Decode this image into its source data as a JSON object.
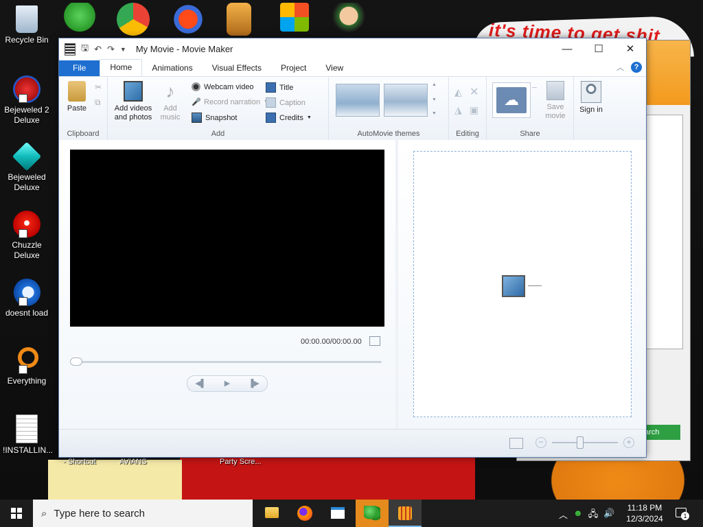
{
  "desktop": {
    "icons": [
      {
        "label": "Recycle Bin"
      },
      {
        "label": "Bejeweled 2 Deluxe"
      },
      {
        "label": "Bejeweled Deluxe"
      },
      {
        "label": "Chuzzle Deluxe"
      },
      {
        "label": "doesnt load"
      },
      {
        "label": "Everything"
      },
      {
        "label": "!INSTALLIN..."
      }
    ],
    "wallpaper_text": "it's time to get shit",
    "bottom_labels": [
      "- Shortcut",
      "AVIANS",
      "Party Scre..."
    ],
    "back_window_button": "arch"
  },
  "window": {
    "title": "My Movie - Movie Maker",
    "controls": {
      "minimize": "—",
      "maximize": "☐",
      "close": "✕"
    },
    "tabs": [
      "File",
      "Home",
      "Animations",
      "Visual Effects",
      "Project",
      "View"
    ],
    "help": "?",
    "ribbon": {
      "clipboard": {
        "label": "Clipboard",
        "paste": "Paste"
      },
      "add": {
        "label": "Add",
        "add_videos": "Add videos and photos",
        "add_music": "Add music",
        "webcam": "Webcam video",
        "narration": "Record narration",
        "snapshot": "Snapshot",
        "title": "Title",
        "caption": "Caption",
        "credits": "Credits"
      },
      "themes": {
        "label": "AutoMovie themes"
      },
      "editing": {
        "label": "Editing"
      },
      "share": {
        "label": "Share",
        "save_movie": "Save movie",
        "sign_in": "Sign in"
      }
    },
    "preview": {
      "timecode": "00:00.00/00:00.00"
    }
  },
  "taskbar": {
    "search_placeholder": "Type here to search",
    "time": "11:18 PM",
    "date": "12/3/2024",
    "notification_count": "1"
  },
  "colors": {
    "accent": "#1e6fd0",
    "ribbon_bg": "#edf2f8",
    "storyboard_border": "#8fb0d6"
  }
}
